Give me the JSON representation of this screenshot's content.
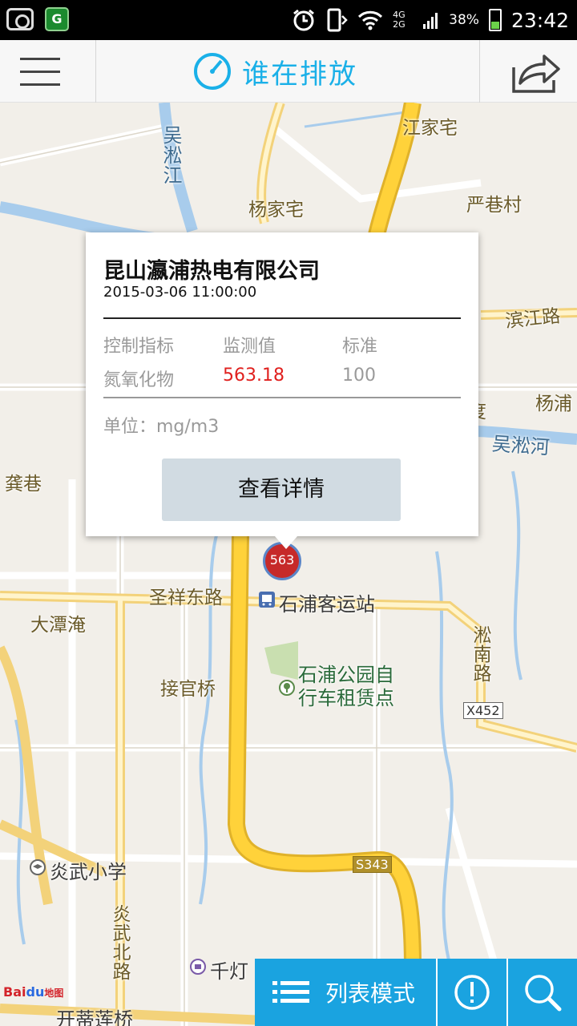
{
  "status_bar": {
    "app_icon_letter": "G",
    "network": "4G 2G",
    "battery": "38%",
    "time": "23:42"
  },
  "header": {
    "title": "谁在排放",
    "menu_icon": "hamburger-icon",
    "share_icon": "share-icon"
  },
  "map": {
    "labels": {
      "wusong_jiang": "吴淞江",
      "jiangjiazhai": "江家宅",
      "yangjiazhai": "杨家宅",
      "yanxiangcun": "严巷村",
      "binjianglu": "滨江路",
      "yangpu": "杨浦",
      "wusonghe": "吴淞河",
      "gongxiang": "龚巷",
      "shengxiangdonglu": "圣祥东路",
      "shipukeyunzhan": "石浦客运站",
      "datanyan": "大潭淹",
      "songnanlu": "淞南路",
      "jieguanqiao": "接官桥",
      "park_line1": "石浦公园自",
      "park_line2": "行车租赁点",
      "yanwuxiaoxue": "炎武小学",
      "yanwubeilu": "炎武北路",
      "qiandeng": "千灯",
      "kaidilianqiao": "开蒂莲桥",
      "fragment_du": "度",
      "road_x452": "X452",
      "road_s343": "S343"
    },
    "marker_value": "563"
  },
  "popup": {
    "company": "昆山瀛浦热电有限公司",
    "datetime": "2015-03-06 11:00:00",
    "headers": [
      "控制指标",
      "监测值",
      "标准"
    ],
    "row": {
      "indicator": "氮氧化物",
      "value": "563.18",
      "standard": "100"
    },
    "unit": "单位：mg/m3",
    "details_button": "查看详情",
    "colors": {
      "value": "#e0201e",
      "muted": "#9a9a9a"
    }
  },
  "bottom_bar": {
    "list_mode": "列表模式",
    "alert_icon": "exclamation-circle-icon",
    "search_icon": "search-icon",
    "accent": "#1aa3e0"
  },
  "baidu_logo": {
    "bai": "Bai",
    "du": "du",
    "ditu": "地图"
  }
}
